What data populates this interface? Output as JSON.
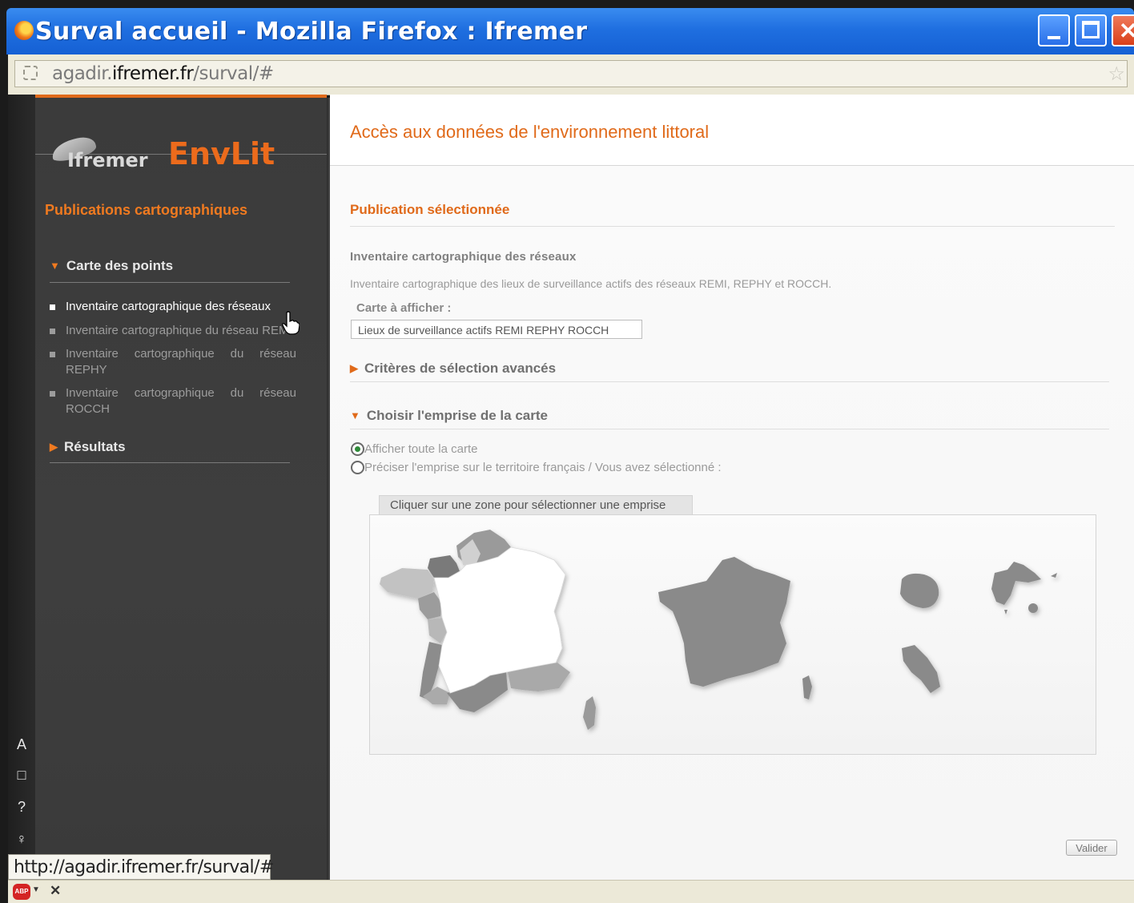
{
  "window": {
    "title": "Surval accueil - Mozilla Firefox : Ifremer"
  },
  "urlbar": {
    "url_prefix": "agadir.",
    "url_domain": "ifremer.fr",
    "url_path": "/surval/#"
  },
  "sidebar": {
    "logo_ifremer": "Ifremer",
    "logo_envlit": "EnvLit",
    "heading": "Publications cartographiques",
    "section_carte": "Carte des points",
    "items": [
      {
        "label": "Inventaire cartographique des réseaux",
        "active": true
      },
      {
        "label": "Inventaire cartographique du réseau REMI",
        "active": false
      },
      {
        "label": "Inventaire cartographique du réseau REPHY",
        "active": false
      },
      {
        "label": "Inventaire cartographique du réseau ROCCH",
        "active": false
      }
    ],
    "section_resultats": "Résultats",
    "strip_icons": [
      "A",
      "□",
      "?",
      "♀"
    ]
  },
  "main": {
    "title": "Accès aux données de l'environnement littoral",
    "selected_pub_label": "Publication sélectionnée",
    "inventory_title": "Inventaire cartographique des réseaux",
    "inventory_desc": "Inventaire cartographique des lieux de surveillance actifs des réseaux REMI, REPHY et ROCCH.",
    "carte_label": "Carte à afficher :",
    "carte_value": "Lieux de surveillance actifs REMI REPHY ROCCH",
    "criteria_title": "Critères de sélection avancés",
    "emprise_title": "Choisir l'emprise de la carte",
    "radio_all": "Afficher toute la carte",
    "radio_precise": "Préciser l'emprise sur le territoire français / Vous avez sélectionné :",
    "map_tab": "Cliquer sur une zone pour sélectionner une emprise",
    "valider": "Valider"
  },
  "status": {
    "url": "http://agadir.ifremer.fr/surval/#",
    "abp_label": "ABP"
  },
  "colors": {
    "accent": "#e06a1a",
    "title_blue": "#1f6fe0",
    "sidebar_bg": "#3d3d3d",
    "map_gray": "#8c8c8c"
  }
}
